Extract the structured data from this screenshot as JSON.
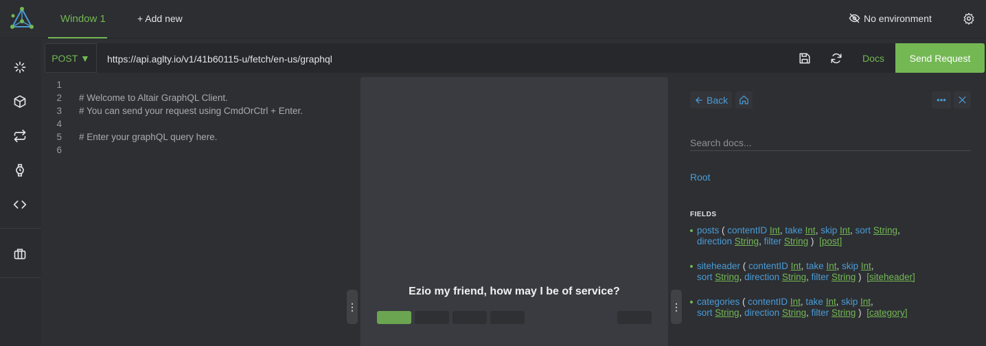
{
  "header": {
    "tab_label": "Window 1",
    "add_new_label": "+ Add new",
    "environment_label": "No environment"
  },
  "request": {
    "method": "POST ▼",
    "url": "https://api.aglty.io/v1/41b60115-u/fetch/en-us/graphql",
    "docs_label": "Docs",
    "send_label": "Send Request"
  },
  "editor": {
    "lines": [
      {
        "num": "1",
        "text": ""
      },
      {
        "num": "2",
        "text": "# Welcome to Altair GraphQL Client."
      },
      {
        "num": "3",
        "text": "# You can send your request using CmdOrCtrl + Enter."
      },
      {
        "num": "4",
        "text": ""
      },
      {
        "num": "5",
        "text": "# Enter your graphQL query here."
      },
      {
        "num": "6",
        "text": ""
      }
    ]
  },
  "result": {
    "message": "Ezio my friend, how may I be of service?"
  },
  "docs": {
    "back_label": "Back",
    "search_placeholder": "Search docs...",
    "root_label": "Root",
    "fields_title": "FIELDS",
    "fields": [
      {
        "name": "posts",
        "args": [
          [
            "contentID",
            "Int"
          ],
          [
            "take",
            "Int"
          ],
          [
            "skip",
            "Int"
          ],
          [
            "sort",
            "String"
          ],
          [
            "direction",
            "String"
          ],
          [
            "filter",
            "String"
          ]
        ],
        "returns": "[post]"
      },
      {
        "name": "siteheader",
        "args": [
          [
            "contentID",
            "Int"
          ],
          [
            "take",
            "Int"
          ],
          [
            "skip",
            "Int"
          ],
          [
            "sort",
            "String"
          ],
          [
            "direction",
            "String"
          ],
          [
            "filter",
            "String"
          ]
        ],
        "returns": "[siteheader]"
      },
      {
        "name": "categories",
        "args": [
          [
            "contentID",
            "Int"
          ],
          [
            "take",
            "Int"
          ],
          [
            "skip",
            "Int"
          ],
          [
            "sort",
            "String"
          ],
          [
            "direction",
            "String"
          ],
          [
            "filter",
            "String"
          ]
        ],
        "returns": "[category]"
      }
    ]
  },
  "colors": {
    "accent": "#74b854",
    "link": "#4a9cd6",
    "background": "#2d2f33"
  }
}
